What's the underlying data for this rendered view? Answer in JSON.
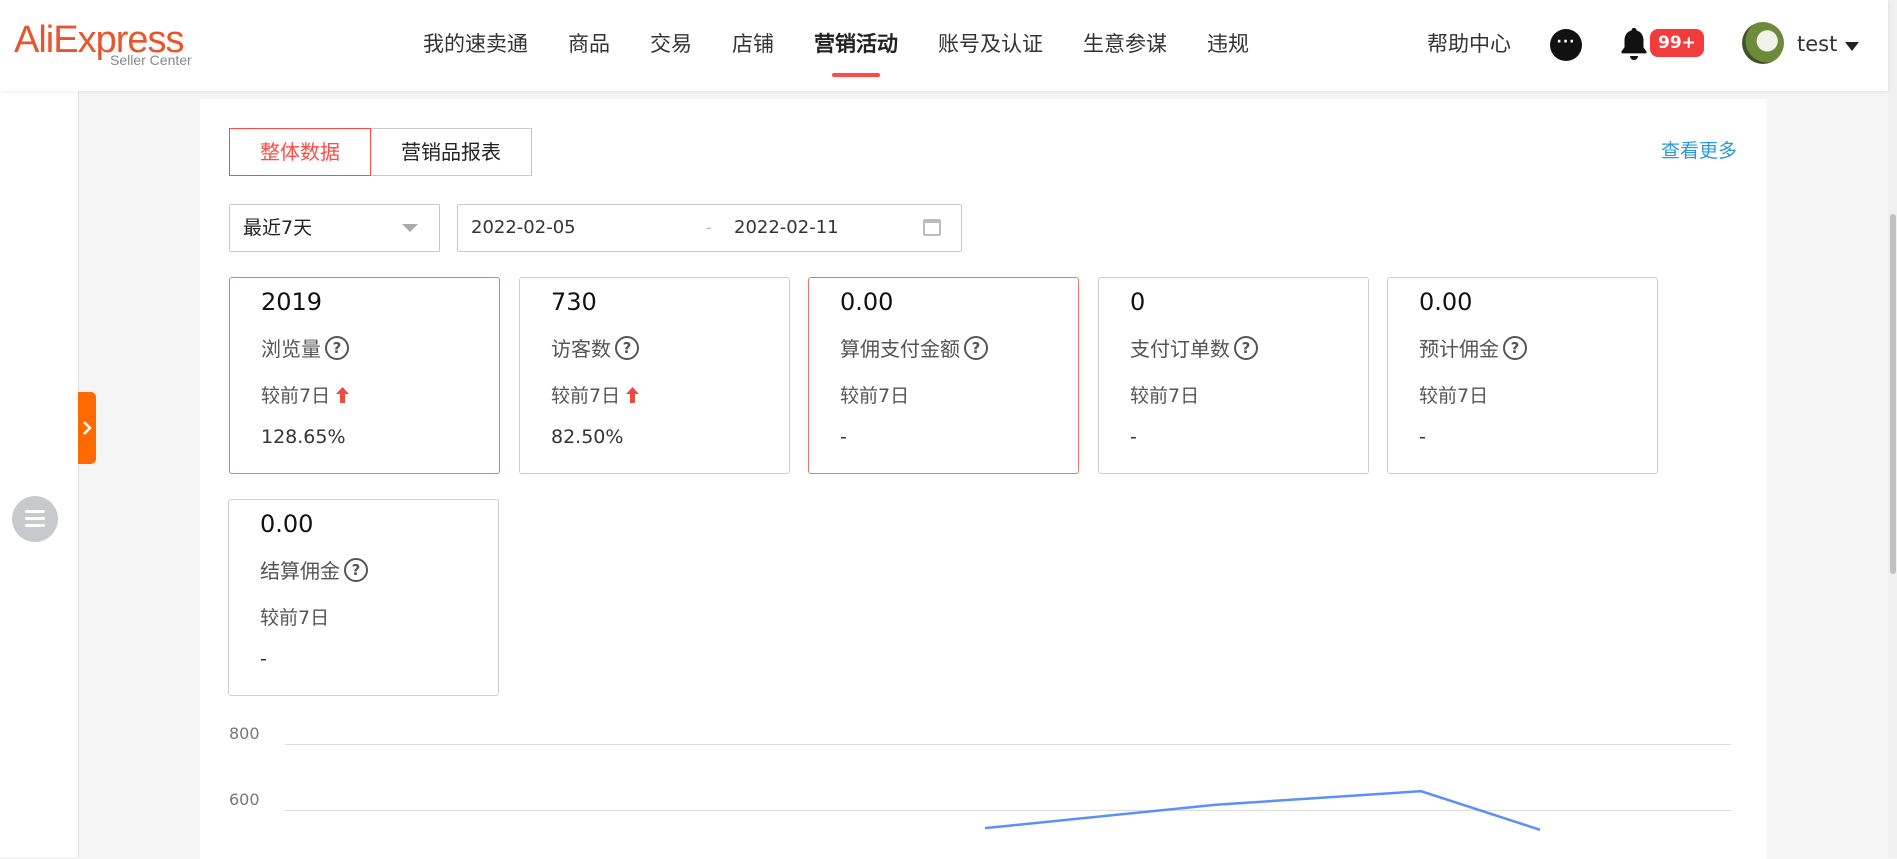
{
  "header": {
    "logo_text": "AliExpress",
    "logo_sub": "Seller Center",
    "nav": [
      {
        "label": "我的速卖通",
        "active": false
      },
      {
        "label": "商品",
        "active": false
      },
      {
        "label": "交易",
        "active": false
      },
      {
        "label": "店铺",
        "active": false
      },
      {
        "label": "营销活动",
        "active": true
      },
      {
        "label": "账号及认证",
        "active": false
      },
      {
        "label": "生意参谋",
        "active": false
      },
      {
        "label": "违规",
        "active": false
      }
    ],
    "help": "帮助中心",
    "notification_badge": "99+",
    "username": "test"
  },
  "tabs": {
    "overall": "整体数据",
    "report": "营销品报表",
    "more": "查看更多"
  },
  "filter": {
    "period": "最近7天",
    "start_date": "2022-02-05",
    "separator": "-",
    "end_date": "2022-02-11"
  },
  "metrics": [
    {
      "value": "2019",
      "label": "浏览量",
      "compare": "较前7日",
      "change": "128.65%",
      "trend": "up"
    },
    {
      "value": "730",
      "label": "访客数",
      "compare": "较前7日",
      "change": "82.50%",
      "trend": "up"
    },
    {
      "value": "0.00",
      "label": "算佣支付金额",
      "compare": "较前7日",
      "change": "-",
      "trend": "none"
    },
    {
      "value": "0",
      "label": "支付订单数",
      "compare": "较前7日",
      "change": "-",
      "trend": "none"
    },
    {
      "value": "0.00",
      "label": "预计佣金",
      "compare": "较前7日",
      "change": "-",
      "trend": "none"
    },
    {
      "value": "0.00",
      "label": "结算佣金",
      "compare": "较前7日",
      "change": "-",
      "trend": "none"
    }
  ],
  "chart_data": {
    "type": "line",
    "y_ticks": [
      "800",
      "600"
    ],
    "series": [
      {
        "values": [
          545,
          616,
          657,
          540
        ]
      }
    ],
    "color": "#5b8ff9"
  },
  "colors": {
    "accent": "#ff4a48",
    "link": "#2a9ad6",
    "side_tab": "#ff6a00"
  }
}
